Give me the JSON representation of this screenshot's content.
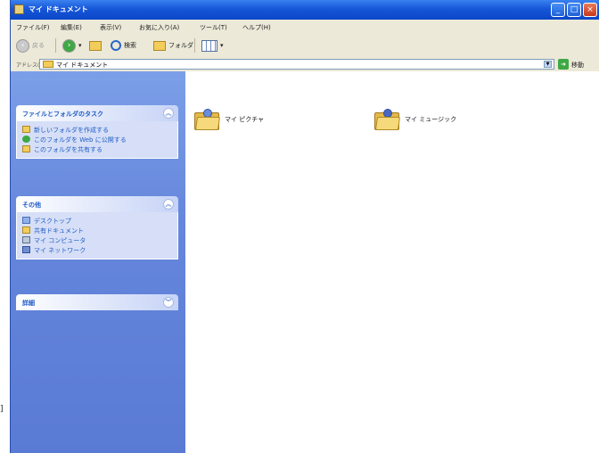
{
  "window": {
    "title": "マイ ドキュメント",
    "controls": {
      "minimize_icon": "minimize-icon",
      "maximize_icon": "maximize-icon",
      "close_icon": "close-icon"
    }
  },
  "menu": {
    "items": [
      "ファイル(F)",
      "編集(E)",
      "表示(V)",
      "お気に入り(A)",
      "ツール(T)",
      "ヘルプ(H)"
    ]
  },
  "toolbar": {
    "back_label": "戻る",
    "search_label": "検索",
    "folders_label": "フォルダ"
  },
  "address": {
    "label": "アドレス(D)",
    "value": "マイ ドキュメント",
    "go_label": "移動"
  },
  "taskpane": {
    "file_tasks": {
      "title": "ファイルとフォルダのタスク",
      "items": [
        "新しいフォルダを作成する",
        "このフォルダを Web に公開する",
        "このフォルダを共有する"
      ]
    },
    "other_places": {
      "title": "その他",
      "items": [
        "デスクトップ",
        "共有ドキュメント",
        "マイ コンピュータ",
        "マイ ネットワーク"
      ]
    },
    "details": {
      "title": "詳細"
    }
  },
  "content": {
    "items": [
      {
        "label": "マイ ピクチャ"
      },
      {
        "label": "マイ ミュージック"
      }
    ]
  },
  "gutter": {
    "mark": "]"
  },
  "colors": {
    "titlebar": "#0b47c8",
    "taskpane": "#6586dc",
    "link": "#215dc6"
  }
}
